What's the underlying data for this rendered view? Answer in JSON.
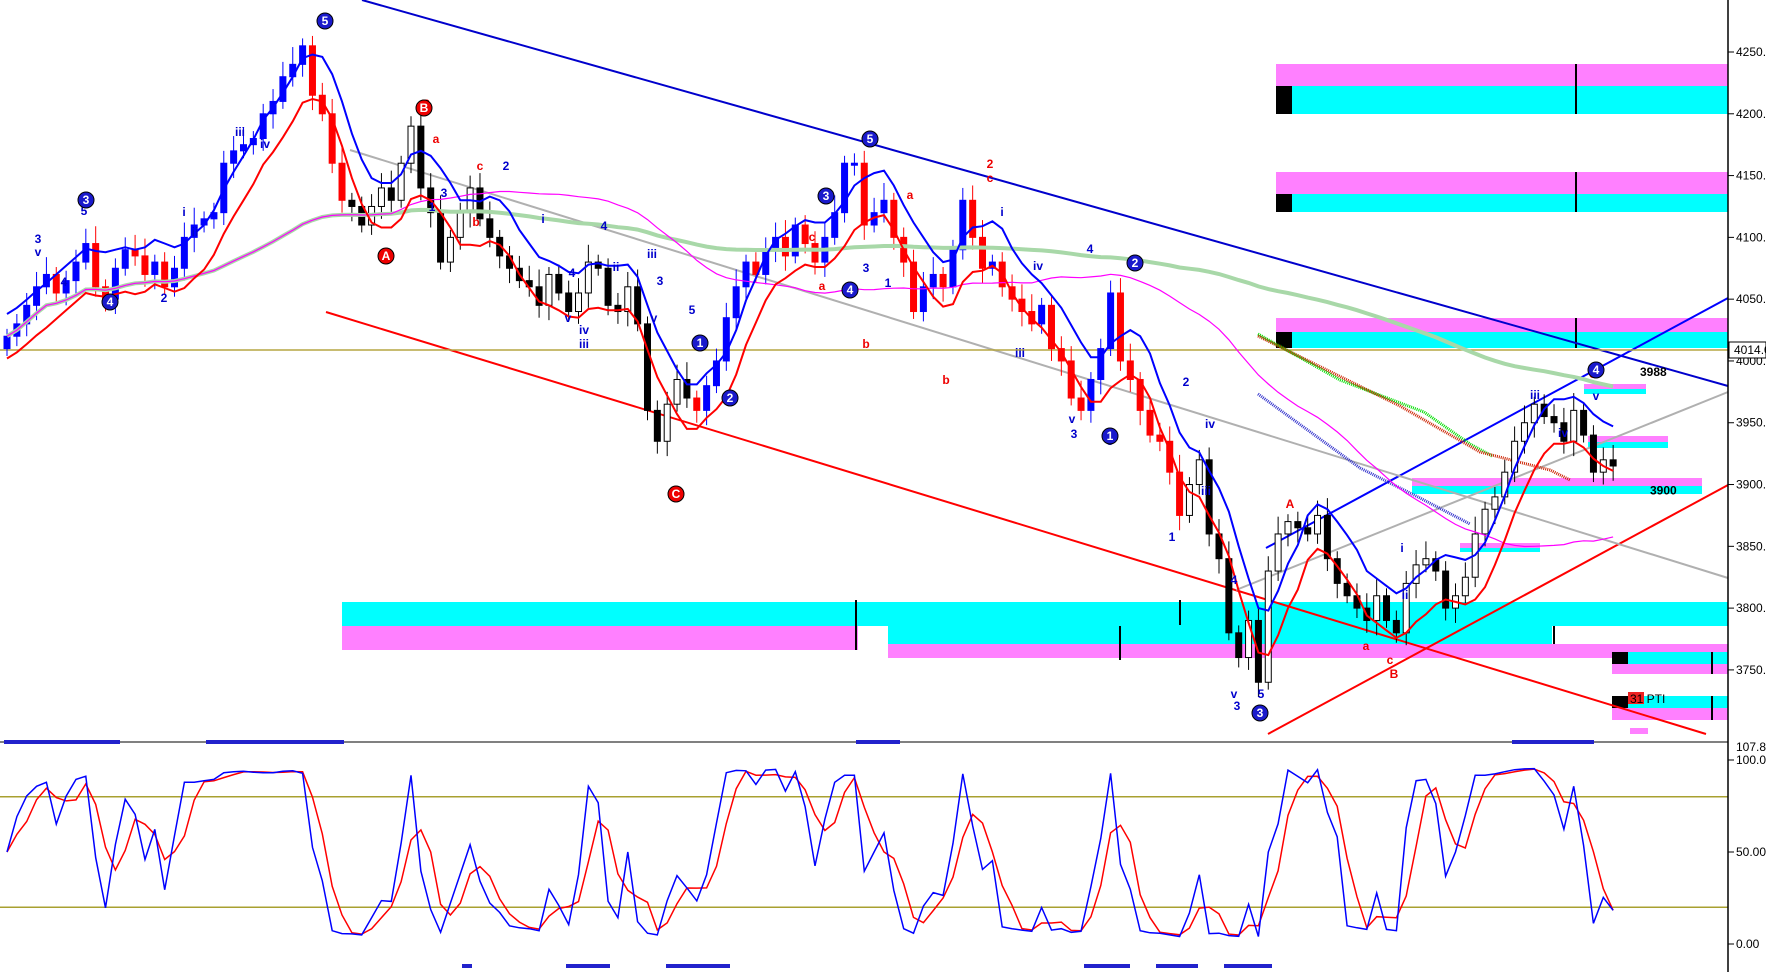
{
  "chart_data": {
    "type": "candlestick",
    "price_axis": {
      "ylim": [
        3680,
        4290
      ],
      "ticks": [
        "4250.00",
        "4200.00",
        "4150.00",
        "4100.00",
        "4050.00",
        "4000.00",
        "3950.00",
        "3900.00",
        "3850.00",
        "3800.00",
        "3750.00"
      ],
      "tick_values": [
        4250,
        4200,
        4150,
        4100,
        4050,
        4000,
        3950,
        3900,
        3850,
        3800,
        3750
      ],
      "current_price_label": "4014.0",
      "current_price": 4014,
      "price_tags": [
        {
          "text": "3988",
          "value": 3988
        },
        {
          "text": "3900",
          "value": 3892
        }
      ],
      "pti_label": "31 PTI"
    },
    "oscillator_axis": {
      "ylim": [
        0,
        100
      ],
      "ticks": [
        "100.00",
        "50.00",
        "0.00"
      ],
      "tick_values": [
        100,
        50,
        0
      ],
      "top_value_label": "107.8",
      "levels": [
        80,
        20
      ]
    },
    "price_closes": [
      4020,
      4030,
      4045,
      4060,
      4070,
      4055,
      4065,
      4080,
      4095,
      4060,
      4050,
      4075,
      4090,
      4085,
      4070,
      4080,
      4060,
      4075,
      4100,
      4110,
      4115,
      4120,
      4160,
      4170,
      4175,
      4180,
      4200,
      4210,
      4230,
      4240,
      4255,
      4215,
      4200,
      4160,
      4130,
      4125,
      4110,
      4125,
      4140,
      4130,
      4160,
      4190,
      4140,
      4120,
      4080,
      4100,
      4120,
      4140,
      4115,
      4100,
      4085,
      4075,
      4065,
      4060,
      4045,
      4070,
      4055,
      4040,
      4055,
      4080,
      4075,
      4045,
      4040,
      4060,
      4030,
      3960,
      3935,
      3965,
      3985,
      3970,
      3960,
      3980,
      4000,
      4035,
      4060,
      4080,
      4070,
      4090,
      4100,
      4085,
      4110,
      4095,
      4080,
      4100,
      4120,
      4160,
      4160,
      4110,
      4120,
      4130,
      4100,
      4080,
      4040,
      4060,
      4070,
      4060,
      4090,
      4130,
      4100,
      4075,
      4080,
      4060,
      4050,
      4040,
      4030,
      4045,
      4010,
      4000,
      3970,
      3960,
      3985,
      4010,
      4055,
      4000,
      3985,
      3960,
      3940,
      3935,
      3910,
      3875,
      3900,
      3920,
      3860,
      3840,
      3780,
      3760,
      3790,
      3740,
      3830,
      3860,
      3870,
      3865,
      3860,
      3875,
      3840,
      3820,
      3810,
      3800,
      3790,
      3810,
      3790,
      3780,
      3820,
      3835,
      3840,
      3830,
      3800,
      3810,
      3825,
      3860,
      3880,
      3890,
      3910,
      3935,
      3950,
      3965,
      3955,
      3950,
      3935,
      3960,
      3940,
      3910,
      3920,
      3915
    ],
    "series": [
      {
        "color": "#0000ff"
      },
      {
        "color": "#ff0000"
      },
      {
        "color": "#ff00ff"
      },
      {
        "color": "#a8d8a8"
      }
    ],
    "zones": {
      "cyan": "#00ffff",
      "magenta": "#ff80ff"
    },
    "wave_labels": [
      {
        "text": "3",
        "color": "blue"
      },
      {
        "text": "v",
        "color": "blue"
      },
      {
        "text": "4",
        "color": "blue"
      },
      {
        "text": "5",
        "color": "blue"
      },
      {
        "text": "i",
        "color": "blue"
      },
      {
        "text": "2",
        "color": "blue"
      },
      {
        "text": "ii",
        "color": "blue"
      },
      {
        "text": "iii",
        "color": "blue"
      },
      {
        "text": "iv",
        "color": "blue"
      },
      {
        "text": "1",
        "color": "blue"
      },
      {
        "text": "3",
        "color": "blue"
      },
      {
        "text": "B",
        "color": "red"
      },
      {
        "text": "a",
        "color": "red"
      },
      {
        "text": "c",
        "color": "red"
      },
      {
        "text": "b",
        "color": "red"
      },
      {
        "text": "2",
        "color": "blue"
      },
      {
        "text": "i",
        "color": "blue"
      },
      {
        "text": "4",
        "color": "blue"
      },
      {
        "text": "ii",
        "color": "blue"
      },
      {
        "text": "iv",
        "color": "blue"
      },
      {
        "text": "iii",
        "color": "blue"
      },
      {
        "text": "v",
        "color": "blue"
      },
      {
        "text": "3",
        "color": "blue"
      },
      {
        "text": "iii",
        "color": "blue"
      },
      {
        "text": "v",
        "color": "blue"
      },
      {
        "text": "5",
        "color": "blue"
      },
      {
        "text": "3",
        "color": "blue"
      },
      {
        "text": "b",
        "color": "red"
      },
      {
        "text": "a",
        "color": "red"
      },
      {
        "text": "c",
        "color": "red"
      },
      {
        "text": "4",
        "color": "blue"
      },
      {
        "text": "1",
        "color": "blue"
      },
      {
        "text": "2",
        "color": "red"
      },
      {
        "text": "c",
        "color": "red"
      },
      {
        "text": "a",
        "color": "red"
      },
      {
        "text": "b",
        "color": "red"
      },
      {
        "text": "iv",
        "color": "blue"
      },
      {
        "text": "iii",
        "color": "blue"
      },
      {
        "text": "i",
        "color": "blue"
      },
      {
        "text": "4",
        "color": "blue"
      },
      {
        "text": "v",
        "color": "blue"
      },
      {
        "text": "3",
        "color": "blue"
      },
      {
        "text": "5",
        "color": "blue"
      },
      {
        "text": "2",
        "color": "blue"
      },
      {
        "text": "iv",
        "color": "blue"
      },
      {
        "text": "iii",
        "color": "blue"
      },
      {
        "text": "1",
        "color": "blue"
      },
      {
        "text": "4",
        "color": "blue"
      },
      {
        "text": "v",
        "color": "blue"
      },
      {
        "text": "3",
        "color": "blue"
      },
      {
        "text": "5",
        "color": "blue"
      },
      {
        "text": "A",
        "color": "red"
      },
      {
        "text": "a",
        "color": "red"
      },
      {
        "text": "c",
        "color": "red"
      },
      {
        "text": "B",
        "color": "red"
      },
      {
        "text": "i",
        "color": "blue"
      },
      {
        "text": "ii",
        "color": "blue"
      },
      {
        "text": "iii",
        "color": "blue"
      },
      {
        "text": "iv",
        "color": "blue"
      },
      {
        "text": "C",
        "color": "red"
      },
      {
        "text": "v",
        "color": "blue"
      }
    ],
    "circled_labels": [
      {
        "text": "5",
        "color": "blue"
      },
      {
        "text": "3",
        "color": "blue"
      },
      {
        "text": "4",
        "color": "blue"
      },
      {
        "text": "B",
        "color": "red"
      },
      {
        "text": "A",
        "color": "red"
      },
      {
        "text": "1",
        "color": "blue"
      },
      {
        "text": "2",
        "color": "blue"
      },
      {
        "text": "C",
        "color": "red"
      },
      {
        "text": "5",
        "color": "blue"
      },
      {
        "text": "3",
        "color": "blue"
      },
      {
        "text": "4",
        "color": "blue"
      },
      {
        "text": "2",
        "color": "blue"
      },
      {
        "text": "1",
        "color": "blue"
      },
      {
        "text": "3",
        "color": "blue"
      },
      {
        "text": "4",
        "color": "blue"
      }
    ]
  }
}
